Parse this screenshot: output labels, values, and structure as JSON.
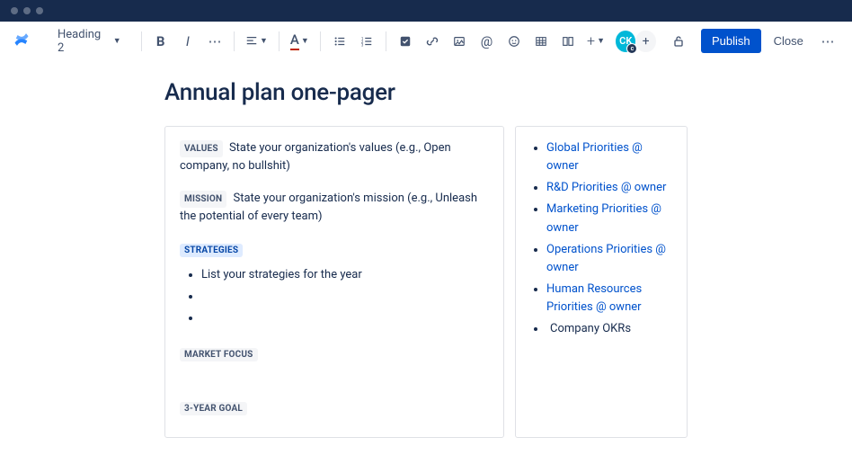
{
  "toolbar": {
    "heading_label": "Heading 2",
    "avatar_initials": "CK",
    "avatar_badge": "c",
    "publish_label": "Publish",
    "close_label": "Close"
  },
  "page": {
    "title": "Annual plan one-pager"
  },
  "left": {
    "values_label": "VALUES",
    "values_text": "State your organization's values (e.g., Open company, no bullshit)",
    "mission_label": "MISSION",
    "mission_text": "State your organization's mission (e.g., Unleash the potential of every team)",
    "strategies_label": "STRATEGIES",
    "strategies_item1": "List your strategies for the year",
    "market_focus_label": "MARKET FOCUS",
    "three_year_goal_label": "3-YEAR GOAL"
  },
  "right": {
    "links": [
      "Global Priorities @ owner",
      "R&D Priorities @ owner",
      "Marketing Priorities @ owner",
      "Operations Priorities @ owner",
      "Human Resources Priorities @ owner"
    ],
    "plain_item": "Company OKRs"
  }
}
